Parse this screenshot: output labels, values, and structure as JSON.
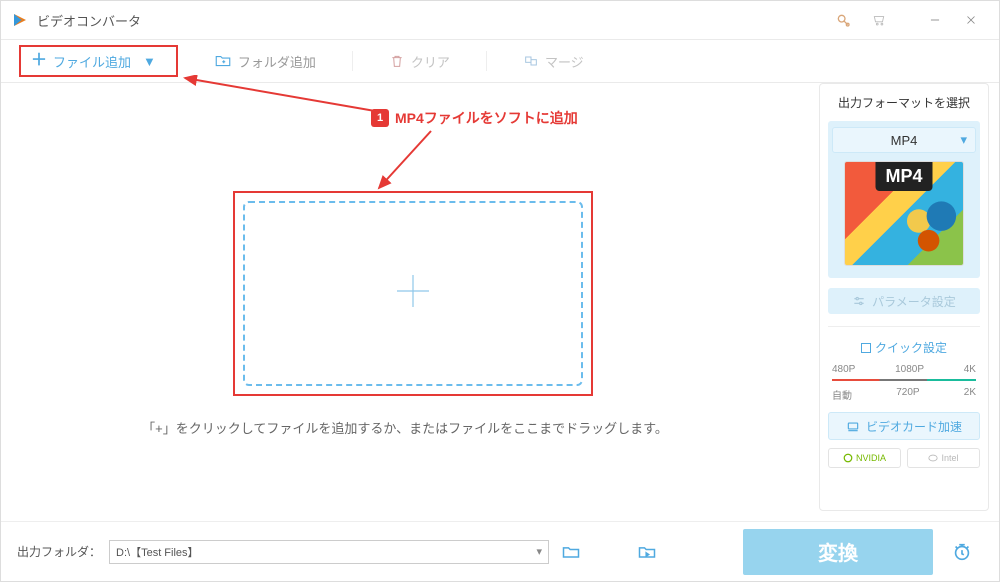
{
  "titlebar": {
    "title": "ビデオコンバータ"
  },
  "toolbar": {
    "add_file": "ファイル追加",
    "add_folder": "フォルダ追加",
    "clear": "クリア",
    "merge": "マージ"
  },
  "callout": {
    "step": "1",
    "text": "MP4ファイルをソフトに追加"
  },
  "dropzone": {
    "hint": "「+」をクリックしてファイルを追加するか、またはファイルをここまでドラッグします。"
  },
  "rightpanel": {
    "title": "出力フォーマットを選択",
    "format_selected": "MP4",
    "format_badge": "MP4",
    "param_button": "パラメータ設定",
    "quick_title": "クイック設定",
    "quality_top": [
      "480P",
      "1080P",
      "4K"
    ],
    "quality_bottom": [
      "自動",
      "720P",
      "2K"
    ],
    "gpu_button": "ビデオカード加速",
    "vendor_nvidia": "NVIDIA",
    "vendor_intel": "Intel"
  },
  "bottombar": {
    "label": "出力フォルダ：",
    "path": "D:\\【Test Files】",
    "convert": "変換"
  }
}
